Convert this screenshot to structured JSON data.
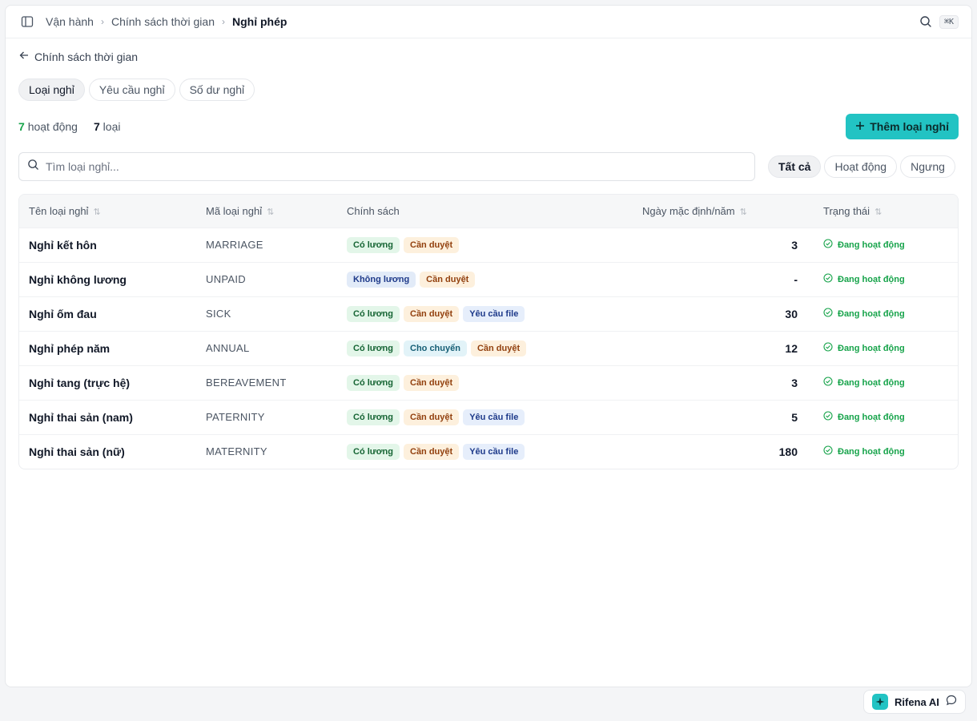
{
  "breadcrumb": [
    "Vận hành",
    "Chính sách thời gian",
    "Nghỉ phép"
  ],
  "shortcut": "⌘K",
  "back_label": "Chính sách thời gian",
  "tabs": [
    "Loại nghỉ",
    "Yêu cầu nghỉ",
    "Số dư nghỉ"
  ],
  "stats": {
    "active_count": "7",
    "active_label": "hoạt động",
    "total_count": "7",
    "total_label": "loại"
  },
  "add_button": "Thêm loại nghỉ",
  "search": {
    "placeholder": "Tìm loại nghỉ..."
  },
  "filters": [
    "Tất cả",
    "Hoạt động",
    "Ngưng"
  ],
  "table": {
    "headers": [
      "Tên loại nghỉ",
      "Mã loại nghỉ",
      "Chính sách",
      "Ngày mặc định/năm",
      "Trạng thái"
    ],
    "rows": [
      {
        "name": "Nghỉ kết hôn",
        "code": "MARRIAGE",
        "badges": [
          {
            "t": "Có lương",
            "k": "paid"
          },
          {
            "t": "Cần duyệt",
            "k": "approve"
          }
        ],
        "days": "3",
        "status": "Đang hoạt động"
      },
      {
        "name": "Nghỉ không lương",
        "code": "UNPAID",
        "badges": [
          {
            "t": "Không lương",
            "k": "unpaid"
          },
          {
            "t": "Cần duyệt",
            "k": "approve"
          }
        ],
        "days": "-",
        "status": "Đang hoạt động"
      },
      {
        "name": "Nghỉ ốm đau",
        "code": "SICK",
        "badges": [
          {
            "t": "Có lương",
            "k": "paid"
          },
          {
            "t": "Cần duyệt",
            "k": "approve"
          },
          {
            "t": "Yêu cầu file",
            "k": "file"
          }
        ],
        "days": "30",
        "status": "Đang hoạt động"
      },
      {
        "name": "Nghỉ phép năm",
        "code": "ANNUAL",
        "badges": [
          {
            "t": "Có lương",
            "k": "paid"
          },
          {
            "t": "Cho chuyển",
            "k": "transfer"
          },
          {
            "t": "Cần duyệt",
            "k": "approve"
          }
        ],
        "days": "12",
        "status": "Đang hoạt động"
      },
      {
        "name": "Nghỉ tang (trực hệ)",
        "code": "BEREAVEMENT",
        "badges": [
          {
            "t": "Có lương",
            "k": "paid"
          },
          {
            "t": "Cần duyệt",
            "k": "approve"
          }
        ],
        "days": "3",
        "status": "Đang hoạt động"
      },
      {
        "name": "Nghỉ thai sản (nam)",
        "code": "PATERNITY",
        "badges": [
          {
            "t": "Có lương",
            "k": "paid"
          },
          {
            "t": "Cần duyệt",
            "k": "approve"
          },
          {
            "t": "Yêu cầu file",
            "k": "file"
          }
        ],
        "days": "5",
        "status": "Đang hoạt động"
      },
      {
        "name": "Nghỉ thai sản (nữ)",
        "code": "MATERNITY",
        "badges": [
          {
            "t": "Có lương",
            "k": "paid"
          },
          {
            "t": "Cần duyệt",
            "k": "approve"
          },
          {
            "t": "Yêu cầu file",
            "k": "file"
          }
        ],
        "days": "180",
        "status": "Đang hoạt động"
      }
    ]
  },
  "ai_button": "Rifena AI",
  "colors": {
    "accent": "#22c3c3",
    "active_green": "#16a34a"
  }
}
